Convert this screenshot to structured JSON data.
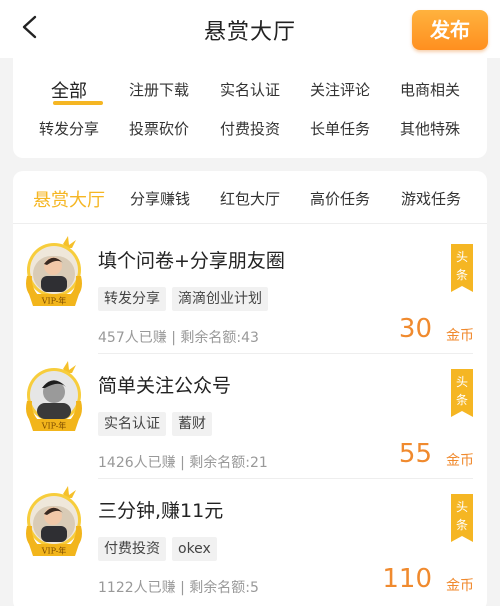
{
  "header": {
    "title": "悬赏大厅",
    "publish_label": "发布"
  },
  "categories": {
    "row1": [
      "全部",
      "注册下载",
      "实名认证",
      "关注评论",
      "电商相关"
    ],
    "row2": [
      "转发分享",
      "投票砍价",
      "付费投资",
      "长单任务",
      "其他特殊"
    ],
    "active": "全部"
  },
  "tabs": [
    "悬赏大厅",
    "分享赚钱",
    "红包大厅",
    "高价任务",
    "游戏任务"
  ],
  "active_tab": "悬赏大厅",
  "tasks": [
    {
      "title": "填个问卷+分享朋友圈",
      "tags": [
        "转发分享",
        "滴滴创业计划"
      ],
      "earned": "457人已赚",
      "separator": "|",
      "remaining_label": "剩余名额:",
      "remaining": "43",
      "reward": "30",
      "unit": "金币",
      "badge_top": "头",
      "badge_bottom": "条",
      "vip": "VIP-年",
      "avatar": "toddler-photo"
    },
    {
      "title": "简单关注公众号",
      "tags": [
        "实名认证",
        "蓄财"
      ],
      "earned": "1426人已赚",
      "separator": "|",
      "remaining_label": "剩余名额:",
      "remaining": "21",
      "reward": "55",
      "unit": "金币",
      "badge_top": "头",
      "badge_bottom": "条",
      "vip": "VIP-年",
      "avatar": "man-bw-photo"
    },
    {
      "title": "三分钟,赚11元",
      "tags": [
        "付费投资",
        "okex"
      ],
      "earned": "1122人已赚",
      "separator": "|",
      "remaining_label": "剩余名额:",
      "remaining": "5",
      "reward": "110",
      "unit": "金币",
      "badge_top": "头",
      "badge_bottom": "条",
      "vip": "VIP-年",
      "avatar": "toddler-photo"
    }
  ],
  "colors": {
    "accent": "#f5b623",
    "reward": "#f08a2e",
    "publish_gradient_top": "#ffb23e",
    "publish_gradient_bottom": "#ff8f1f",
    "background": "#f3f3f3"
  }
}
